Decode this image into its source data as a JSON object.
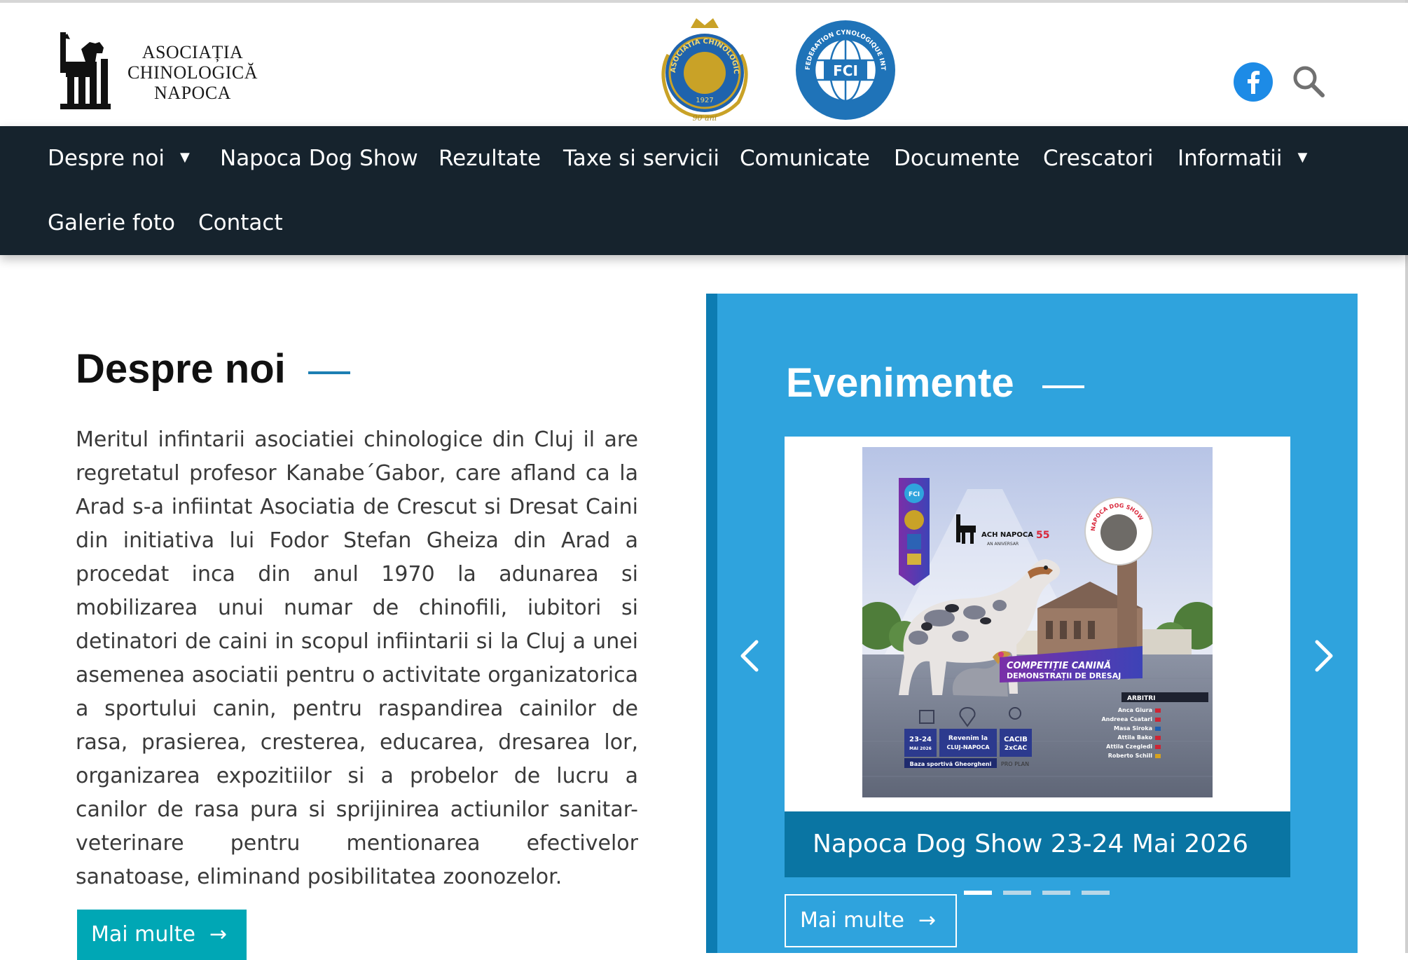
{
  "header": {
    "logo_lines": [
      "ASOCIAȚIA",
      "CHINOLOGICĂ",
      "NAPOCA"
    ],
    "seal_acr_text": "ASOCIATIA CHINOLOGICA ROMANA",
    "seal_acr_year": "1927",
    "seal_acr_anniv": "90 ani",
    "seal_fci_text": "FEDERATION CYNOLOGIQUE INTERNATIONALE",
    "seal_fci_abbr": "FCI",
    "icons": [
      "facebook-icon",
      "search-icon"
    ]
  },
  "nav": {
    "items": [
      {
        "label": "Despre noi",
        "has_dropdown": true
      },
      {
        "label": "Napoca Dog Show",
        "has_dropdown": false
      },
      {
        "label": "Rezultate",
        "has_dropdown": false
      },
      {
        "label": "Taxe si servicii",
        "has_dropdown": false
      },
      {
        "label": "Comunicate",
        "has_dropdown": false
      },
      {
        "label": "Documente",
        "has_dropdown": false
      },
      {
        "label": "Crescatori",
        "has_dropdown": false
      },
      {
        "label": "Informatii",
        "has_dropdown": true
      },
      {
        "label": "Galerie foto",
        "has_dropdown": false
      },
      {
        "label": "Contact",
        "has_dropdown": false
      }
    ],
    "caret": "▼"
  },
  "about": {
    "title": "Despre noi",
    "body": "Meritul infintarii asociatiei chinologice din Cluj il are regretatul profesor Kanabe´Gabor, care afland ca la Arad s-a infiintat Asociatia de Crescut si Dresat Caini din initiativa lui Fodor Stefan Gheiza din Arad a procedat inca din anul 1970 la adunarea si mobilizarea unui numar de chinofili, iubitori si detinatori de caini in scopul infiintarii si la Cluj a unei asemenea asociatii pentru o activitate organizatorica a sportului canin, pentru raspandirea cainilor de rasa, prasierea, cresterea, educarea, dresarea lor, organizarea expozitiilor si a probelor de lucru a canilor de rasa pura si sprijinirea actiunilor sanitar-veterinare pentru mentionarea efectivelor sanatoase, eliminand posibilitatea zoonozelor.",
    "button_label": "Mai multe"
  },
  "events": {
    "title": "Evenimente",
    "slide_caption": "Napoca Dog Show 23-24 Mai 2026",
    "button_label": "Mai multe",
    "active_slide": 1,
    "slide_count": 4,
    "poster": {
      "ach_label": "ACH NAPOCA",
      "ach_number": "55",
      "ach_sub": "AN ANIVERSAR",
      "badge_fci": "FCI",
      "sticker_text": "NAPOCA DOG SHOW",
      "competition_line1": "COMPETIȚIE CANINĂ",
      "competition_line2": "DEMONSTRAȚII DE DRESAJ",
      "judges_title": "ARBITRI",
      "judges": [
        "Anca Giura",
        "Andreea Csatari",
        "Masa Siroka",
        "Attila Bako",
        "Attila Czegledi",
        "Roberto Schill"
      ],
      "date_main": "23-24",
      "date_sub": "MAI 2026",
      "location_main": "Revenim la",
      "location_sub": "CLUJ-NAPOCA",
      "cacib_main": "CACIB",
      "cacib_sub": "2xCAC",
      "venue": "Baza sportivă Gheorgheni",
      "sponsor": "PRO PLAN"
    }
  },
  "colors": {
    "nav_bg": "#16232d",
    "events_bg": "#2fa3dd",
    "events_border": "#0d7cb2",
    "caption_bg": "#0a75a3",
    "button_teal": "#00a7b5",
    "title_dash": "#1d7fb3",
    "facebook": "#1d8be6"
  }
}
